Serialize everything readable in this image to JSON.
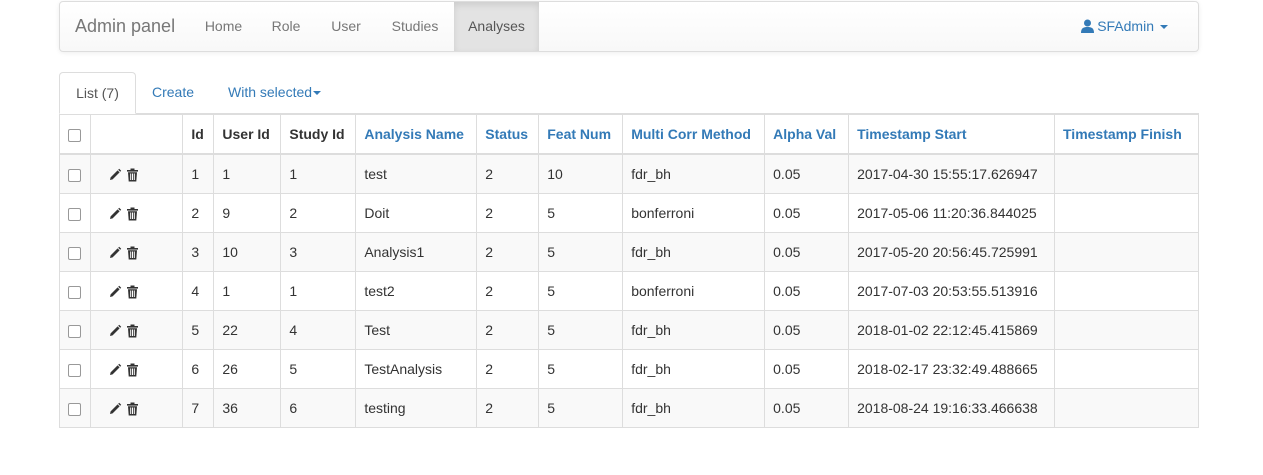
{
  "navbar": {
    "brand": "Admin panel",
    "items": [
      {
        "label": "Home"
      },
      {
        "label": "Role"
      },
      {
        "label": "User"
      },
      {
        "label": "Studies"
      },
      {
        "label": "Analyses",
        "active": true
      }
    ],
    "user": "SFAdmin"
  },
  "tabs": {
    "list": "List (7)",
    "create": "Create",
    "with_selected": "With selected"
  },
  "table": {
    "columns": [
      "Id",
      "User Id",
      "Study Id",
      "Analysis Name",
      "Status",
      "Feat Num",
      "Multi Corr Method",
      "Alpha Val",
      "Timestamp Start",
      "Timestamp Finish"
    ],
    "rows": [
      [
        "1",
        "1",
        "1",
        "test",
        "2",
        "10",
        "fdr_bh",
        "0.05",
        "2017-04-30 15:55:17.626947",
        ""
      ],
      [
        "2",
        "9",
        "2",
        "Doit",
        "2",
        "5",
        "bonferroni",
        "0.05",
        "2017-05-06 11:20:36.844025",
        ""
      ],
      [
        "3",
        "10",
        "3",
        "Analysis1",
        "2",
        "5",
        "fdr_bh",
        "0.05",
        "2017-05-20 20:56:45.725991",
        ""
      ],
      [
        "4",
        "1",
        "1",
        "test2",
        "2",
        "5",
        "bonferroni",
        "0.05",
        "2017-07-03 20:53:55.513916",
        ""
      ],
      [
        "5",
        "22",
        "4",
        "Test",
        "2",
        "5",
        "fdr_bh",
        "0.05",
        "2018-01-02 22:12:45.415869",
        ""
      ],
      [
        "6",
        "26",
        "5",
        "TestAnalysis",
        "2",
        "5",
        "fdr_bh",
        "0.05",
        "2018-02-17 23:32:49.488665",
        ""
      ],
      [
        "7",
        "36",
        "6",
        "testing",
        "2",
        "5",
        "fdr_bh",
        "0.05",
        "2018-08-24 19:16:33.466638",
        ""
      ]
    ]
  },
  "icons": {
    "edit": "pencil-icon",
    "delete": "trash-icon",
    "user": "user-icon"
  },
  "colors": {
    "link": "#337ab7",
    "nav_active_bg": "#e3e3e3"
  }
}
